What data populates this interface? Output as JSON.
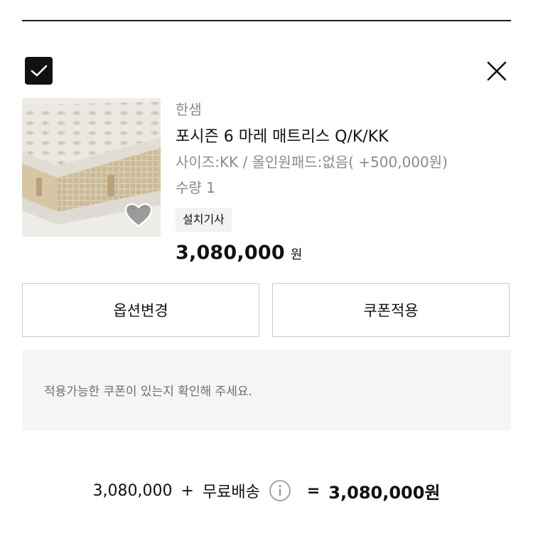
{
  "header": {
    "close_icon": "close-icon",
    "select_icon": "checkbox-checked-icon"
  },
  "product": {
    "brand": "한샘",
    "title": "포시즌 6 마레 매트리스 Q/K/KK",
    "options": "사이즈:KK / 올인원패드:없음( +500,000원)",
    "quantity": "수량 1",
    "tag": "설치기사",
    "price": "3,080,000",
    "price_unit": "원",
    "image_icon": "mattress-image",
    "wishlist_icon": "heart-icon"
  },
  "actions": {
    "change_option": "옵션변경",
    "apply_coupon": "쿠폰적용"
  },
  "coupon": {
    "message": "적용가능한 쿠폰이 있는지 확인해 주세요."
  },
  "summary": {
    "subtotal": "3,080,000",
    "plus": "+",
    "shipping": "무료배송",
    "equals": "=",
    "total": "3,080,000원",
    "info_icon": "info-icon"
  },
  "colors": {
    "text": "#111111",
    "muted": "#8a8a8a",
    "border": "#c9c9c9",
    "panel": "#f5f5f5"
  }
}
